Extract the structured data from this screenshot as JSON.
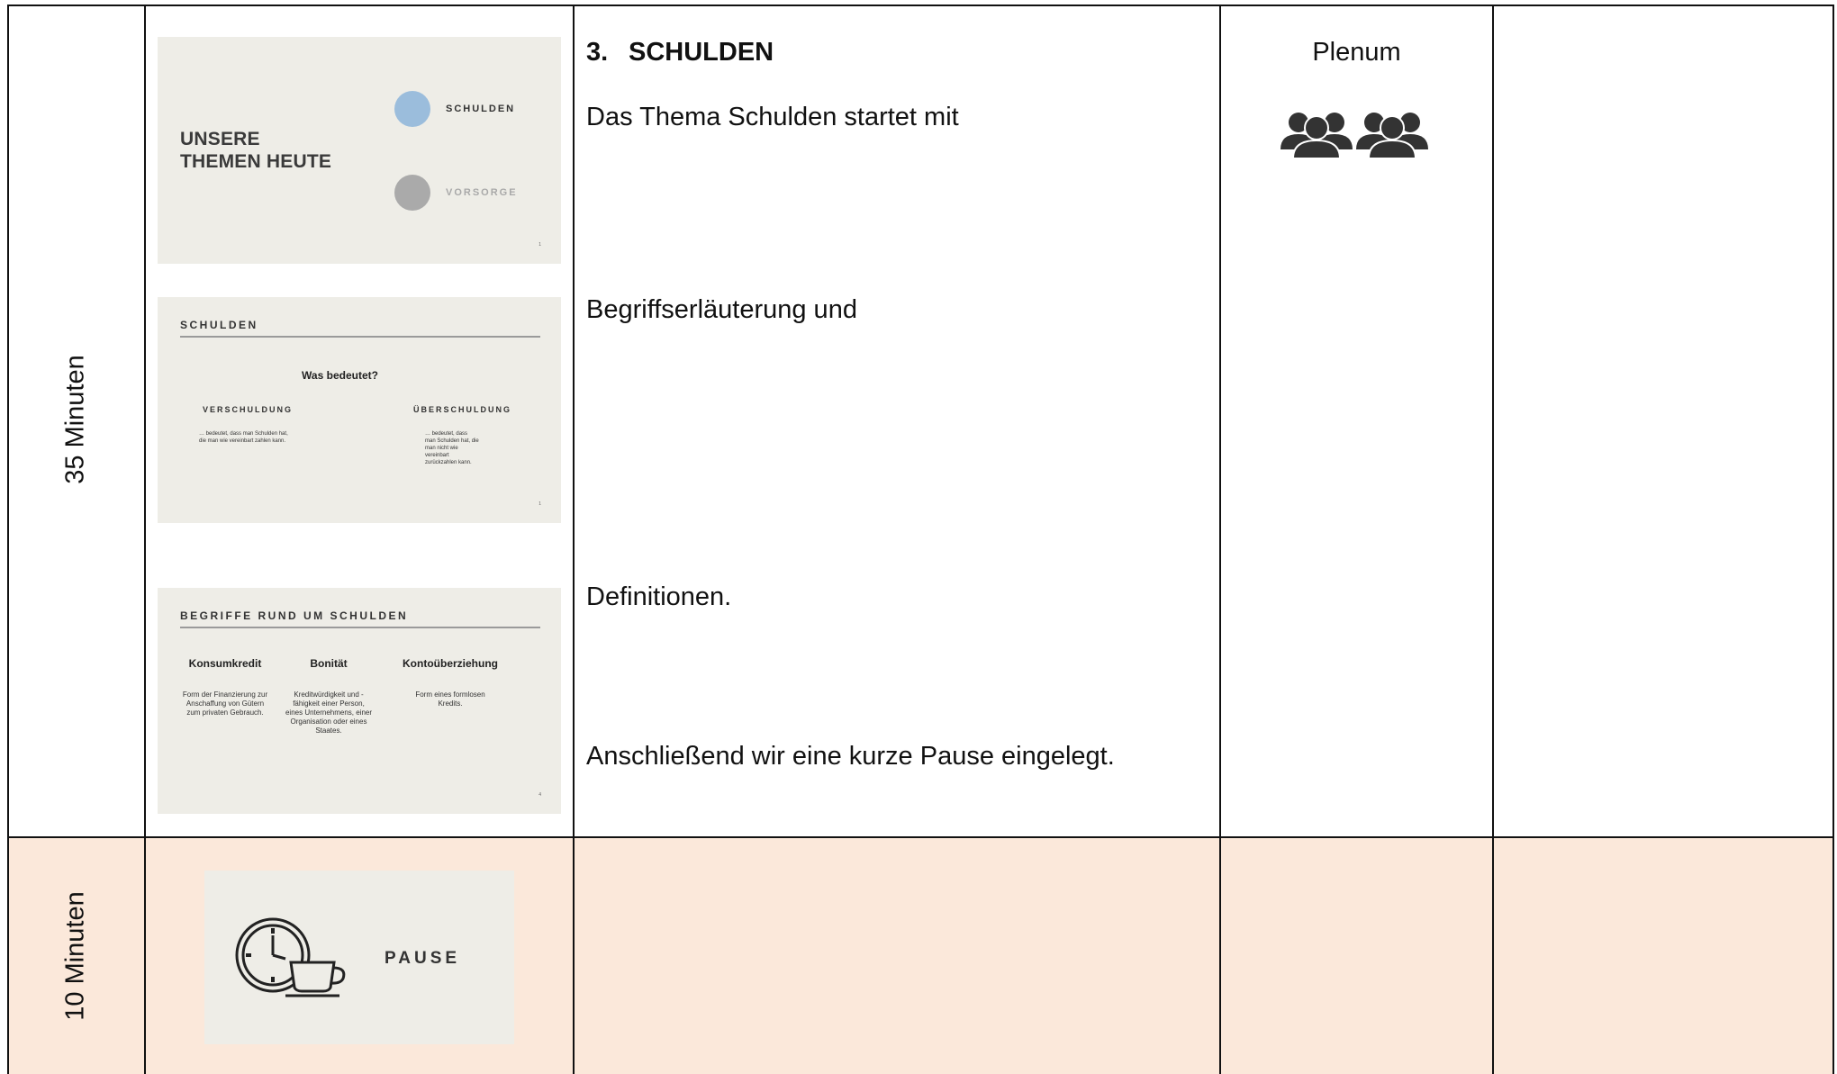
{
  "rows": [
    {
      "duration": "35 Minuten",
      "slides": [
        {
          "title": "UNSERE THEMEN HEUTE",
          "title_lines": [
            "UNSERE",
            "THEMEN HEUTE"
          ],
          "topics": [
            "SCHULDEN",
            "VORSORGE"
          ],
          "topic_colors": [
            "#9bbddc",
            "#aaaaaa"
          ],
          "page": "1"
        },
        {
          "heading": "SCHULDEN",
          "question": "Was bedeutet?",
          "left_term": "VERSCHULDUNG",
          "left_text": "… bedeutet, dass man Schulden hat, die man wie vereinbart zahlen kann.",
          "right_term": "ÜBERSCHULDUNG",
          "right_text": "… bedeutet, dass man Schulden hat, die man nicht wie vereinbart zurückzahlen kann.",
          "page": "1"
        },
        {
          "heading": "BEGRIFFE RUND UM SCHULDEN",
          "columns": [
            {
              "term": "Konsumkredit",
              "text": "Form der Finanzierung zur Anschaffung von Gütern zum privaten Gebrauch."
            },
            {
              "term": "Bonität",
              "text": "Kreditwürdigkeit und -fähigkeit einer Person, eines Unternehmens, einer Organisation oder eines Staates."
            },
            {
              "term": "Kontoüberziehung",
              "text": "Form eines formlosen Kredits."
            }
          ],
          "page": "4"
        }
      ],
      "section_number": "3.",
      "section_title": "SCHULDEN",
      "paragraphs": [
        "Das Thema Schulden startet mit",
        "Begriffserläuterung und",
        "Definitionen.",
        "Anschließend wir eine kurze Pause eingelegt."
      ],
      "social_form": "Plenum",
      "social_icon": "group-people-icon",
      "notes": ""
    },
    {
      "duration": "10 Minuten",
      "slides": [
        {
          "word": "PAUSE",
          "icon": "clock-coffee-icon"
        }
      ],
      "paragraphs": [],
      "social_form": "",
      "notes": "",
      "background": "#fbe8da"
    }
  ]
}
